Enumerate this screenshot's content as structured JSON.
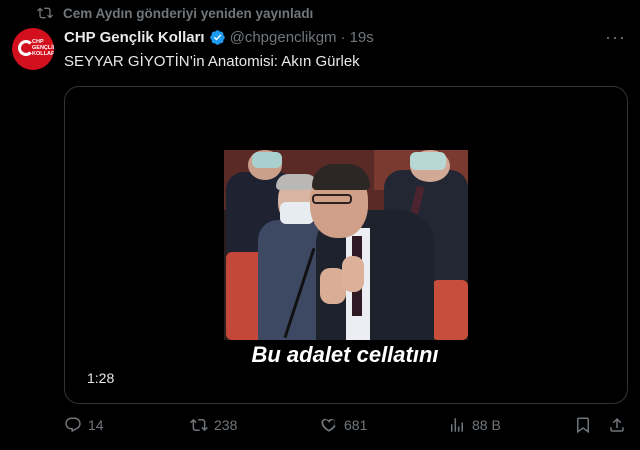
{
  "repost": {
    "label": "Cem Aydın gönderiyi yeniden yayınladı",
    "icon": "repost-icon"
  },
  "author": {
    "name": "CHP Gençlik Kolları",
    "handle": "@chpgenclikgm",
    "separator": "·",
    "time": "19s",
    "avatar_text": "CHP GENÇLİK KOLLARI",
    "avatar_color": "#d2101e",
    "verified_color": "#1d9bf0"
  },
  "tweet": {
    "text": "SEYYAR GİYOTİN’in Anatomisi: Akın Gürlek"
  },
  "media": {
    "subtitle": "Bu adalet cellatını",
    "duration": "1:28"
  },
  "actions": {
    "reply": {
      "icon": "reply-icon",
      "count": "14"
    },
    "repost": {
      "icon": "repost-icon",
      "count": "238"
    },
    "like": {
      "icon": "heart-icon",
      "count": "681"
    },
    "views": {
      "icon": "views-icon",
      "count": "88 B"
    },
    "bookmark": {
      "icon": "bookmark-icon"
    },
    "share": {
      "icon": "share-icon"
    }
  },
  "colors": {
    "background": "#000000",
    "text": "#e7e9ea",
    "muted": "#71767b",
    "border": "#2f3336"
  }
}
